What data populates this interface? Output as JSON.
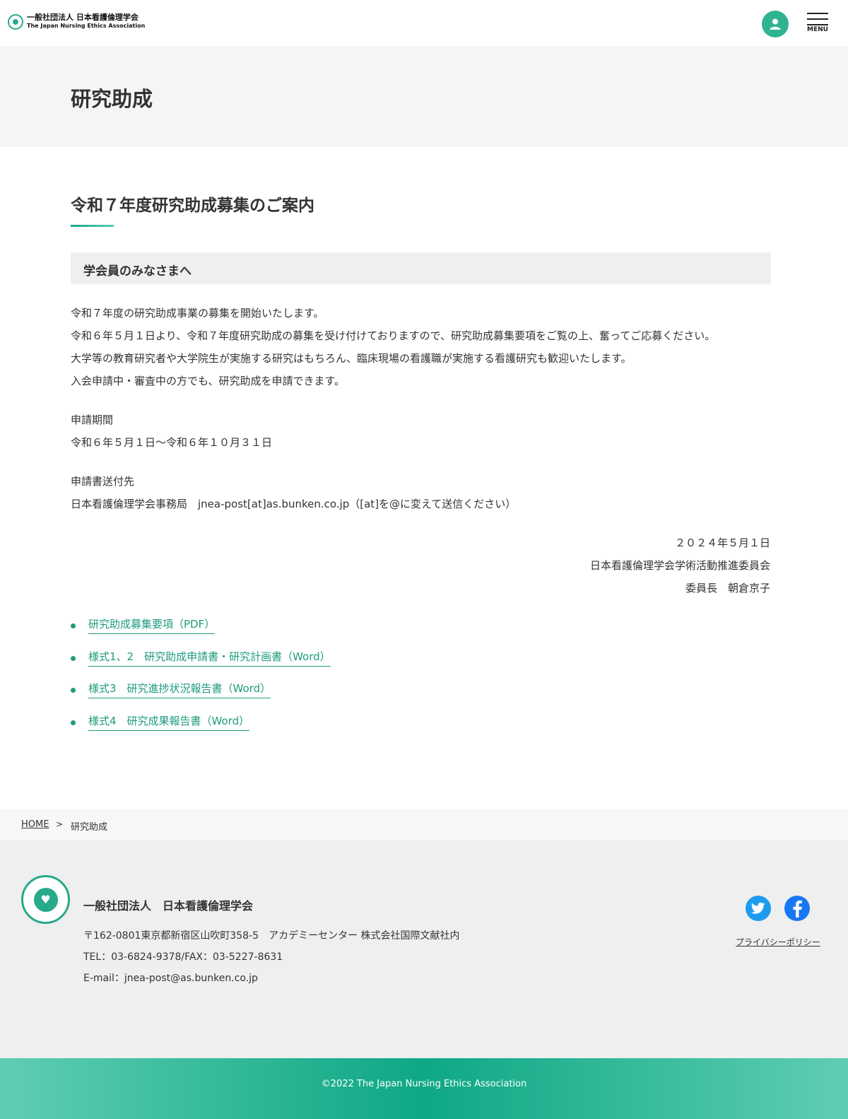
{
  "header": {
    "logo_ja": "一般社団法人 日本看護倫理学会",
    "logo_en": "The Japan Nursing Ethics Association",
    "menu_label": "MENU"
  },
  "page": {
    "title": "研究助成"
  },
  "main": {
    "heading": "令和７年度研究助成募集のご案内",
    "subheading": "学会員のみなさまへ",
    "paragraphs": [
      "令和７年度の研究助成事業の募集を開始いたします。",
      "令和６年５月１日より、令和７年度研究助成の募集を受け付けておりますので、研究助成募集要項をご覧の上、奮ってご応募ください。",
      "大学等の教育研究者や大学院生が実施する研究はもちろん、臨床現場の看護職が実施する看護研究も歓迎いたします。",
      "入会申請中・審査中の方でも、研究助成を申請できます。"
    ],
    "period_label": "申請期間",
    "period_value": "令和６年５月１日〜令和６年１０月３１日",
    "destination_label": "申請書送付先",
    "destination_value": "日本看護倫理学会事務局　jnea-post[at]as.bunken.co.jp（[at]を@に変えて送信ください）",
    "signature": {
      "date": "２０２４年５月１日",
      "committee": "日本看護倫理学会学術活動推進委員会",
      "chair": "委員長　朝倉京子"
    },
    "links": [
      "研究助成募集要項（PDF）",
      "様式1、2　研究助成申請書・研究計画書（Word）",
      "様式3　研究進捗状況報告書（Word）",
      "様式4　研究成果報告書（Word）"
    ]
  },
  "breadcrumb": {
    "home": "HOME",
    "separator": ">",
    "current": "研究助成"
  },
  "footer": {
    "org_name": "一般社団法人　日本看護倫理学会",
    "address": "〒162-0801東京都新宿区山吹町358-5　アカデミーセンター 株式会社国際文献社内",
    "tel_fax": "TEL：03-6824-9378/FAX：03-5227-8631",
    "email": "E-mail：jnea-post@as.bunken.co.jp",
    "privacy": "プライバシーポリシー",
    "copyright": "©2022 The Japan Nursing Ethics Association"
  },
  "icons": {
    "logo": "association-logo-icon",
    "user": "user-icon",
    "menu": "hamburger-menu-icon",
    "twitter": "twitter-icon",
    "facebook": "facebook-icon"
  },
  "colors": {
    "accent": "#2aa88c",
    "link": "#1d9b7d",
    "twitter": "#1d9bf0",
    "facebook": "#1877f2"
  }
}
